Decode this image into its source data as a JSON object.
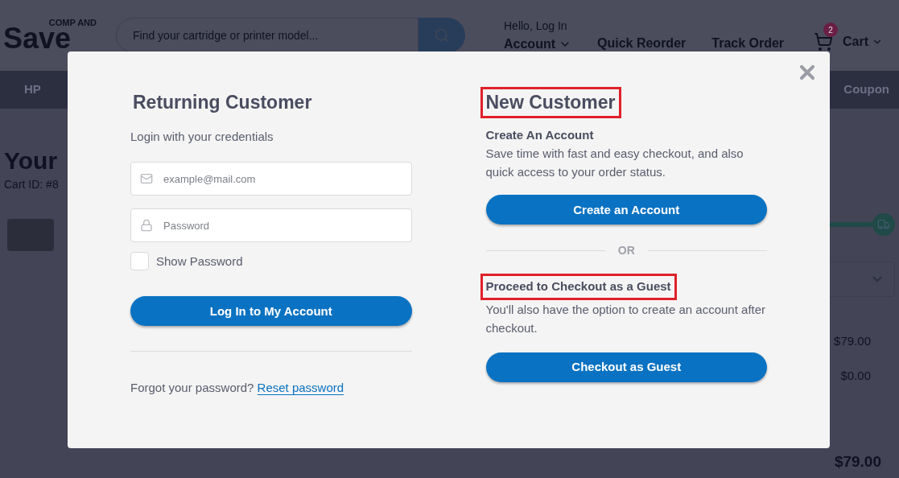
{
  "header": {
    "logo": {
      "top": "COMP AND",
      "bottom": "Save"
    },
    "search": {
      "placeholder": "Find your cartridge or printer model..."
    },
    "greeting": "Hello, Log In",
    "account": "Account",
    "links": [
      "Quick Reorder",
      "Track Order"
    ],
    "cart": {
      "count": "2",
      "label": "Cart"
    }
  },
  "nav": {
    "left_item": "HP",
    "right_item": "Coupon"
  },
  "page": {
    "title": "Your",
    "cart_id": "Cart ID: #8",
    "shipping_progress": {
      "level": 1
    },
    "summary": {
      "amounts": [
        "$79.00",
        "$0.00"
      ],
      "total": "$79.00"
    }
  },
  "modal": {
    "returning": {
      "title": "Returning Customer",
      "subtitle": "Login with your credentials",
      "email": {
        "placeholder": "example@mail.com"
      },
      "password": {
        "placeholder": "Password"
      },
      "show_password": {
        "label": "Show Password",
        "checked": false
      },
      "login_button": "Log In to My Account",
      "forgot_text": "Forgot your password?",
      "reset_link": "Reset password"
    },
    "new": {
      "title": {
        "text": "New Customer",
        "highlighted": true
      },
      "create_heading": "Create An Account",
      "create_text": "Save time with fast and easy checkout, and also quick access to your order status.",
      "create_button": "Create an Account",
      "divider": "OR",
      "guest_heading": {
        "text": "Proceed to Checkout as a Guest",
        "highlighted": true
      },
      "guest_text": "You'll also have the option to create an account after checkout.",
      "guest_button": "Checkout as Guest"
    }
  }
}
